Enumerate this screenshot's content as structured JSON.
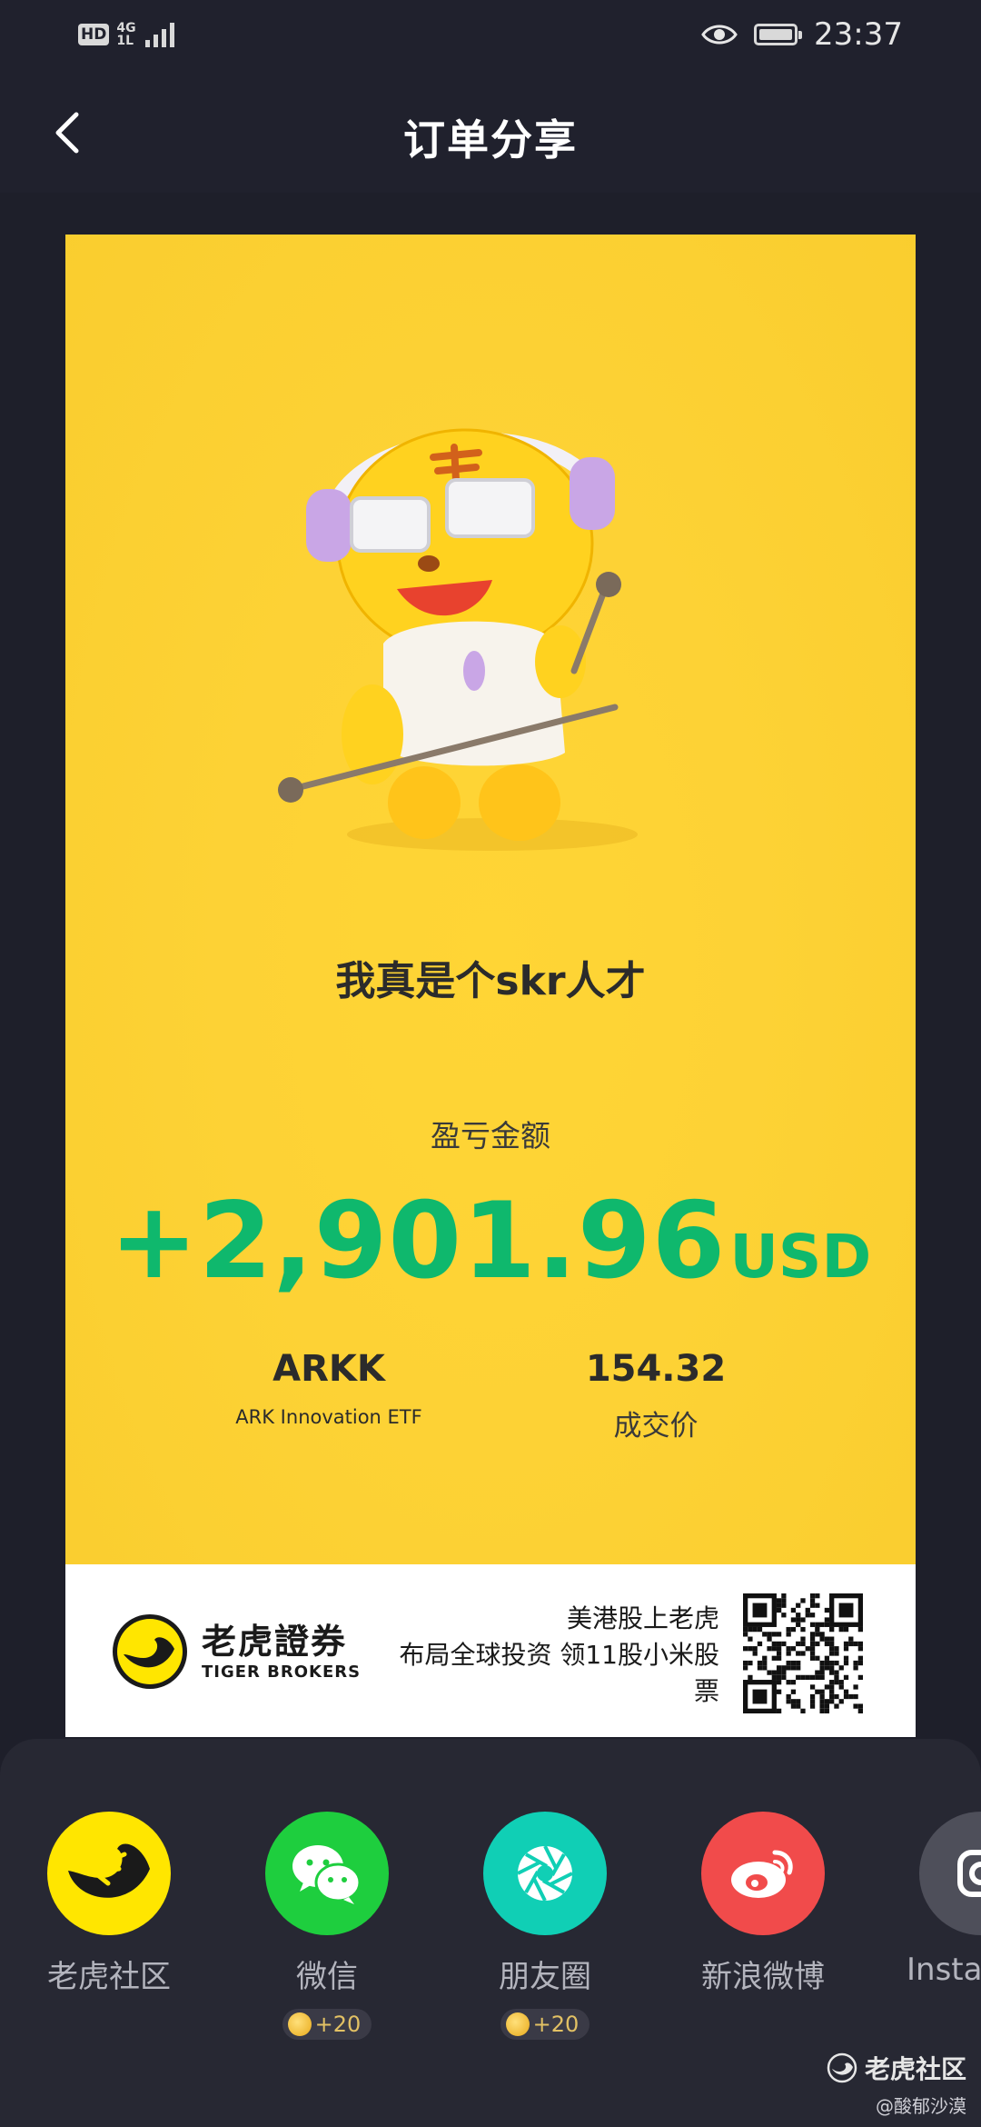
{
  "status_bar": {
    "hd_badge": "HD",
    "network_top": "4G",
    "network_bottom": "1L",
    "time": "23:37",
    "icons": [
      "signal-icon",
      "eye-icon",
      "battery-icon"
    ]
  },
  "nav": {
    "back_icon": "chevron-left-icon",
    "title": "订单分享"
  },
  "card": {
    "slogan": "我真是个skr人才",
    "pl_label": "盈亏金额",
    "pl_value": "+2,901.96",
    "pl_currency": "USD",
    "symbol": "ARKK",
    "symbol_name": "ARK Innovation ETF",
    "price": "154.32",
    "price_label": "成交价",
    "colors": {
      "background": "#fdd235",
      "profit": "#0fb86d"
    }
  },
  "footer": {
    "brand_cn": "老虎證券",
    "brand_en": "TIGER BROKERS",
    "promo_line1": "美港股上老虎",
    "promo_line2": "布局全球投资 领11股小米股",
    "promo_line3": "票"
  },
  "share": {
    "items": [
      {
        "label": "老虎社区",
        "icon": "tiger-community-icon",
        "color": "#ffe600",
        "reward": ""
      },
      {
        "label": "微信",
        "icon": "wechat-icon",
        "color": "#1ece3e",
        "reward": "+20"
      },
      {
        "label": "朋友圈",
        "icon": "moments-icon",
        "color": "#10cfb5",
        "reward": "+20"
      },
      {
        "label": "新浪微博",
        "icon": "weibo-icon",
        "color": "#f14b4b",
        "reward": ""
      },
      {
        "label": "Insta",
        "icon": "instagram-icon",
        "color": "#4e4f5a",
        "reward": ""
      }
    ]
  },
  "watermark": {
    "main": "老虎社区",
    "sub": "@酸郁沙漠"
  }
}
